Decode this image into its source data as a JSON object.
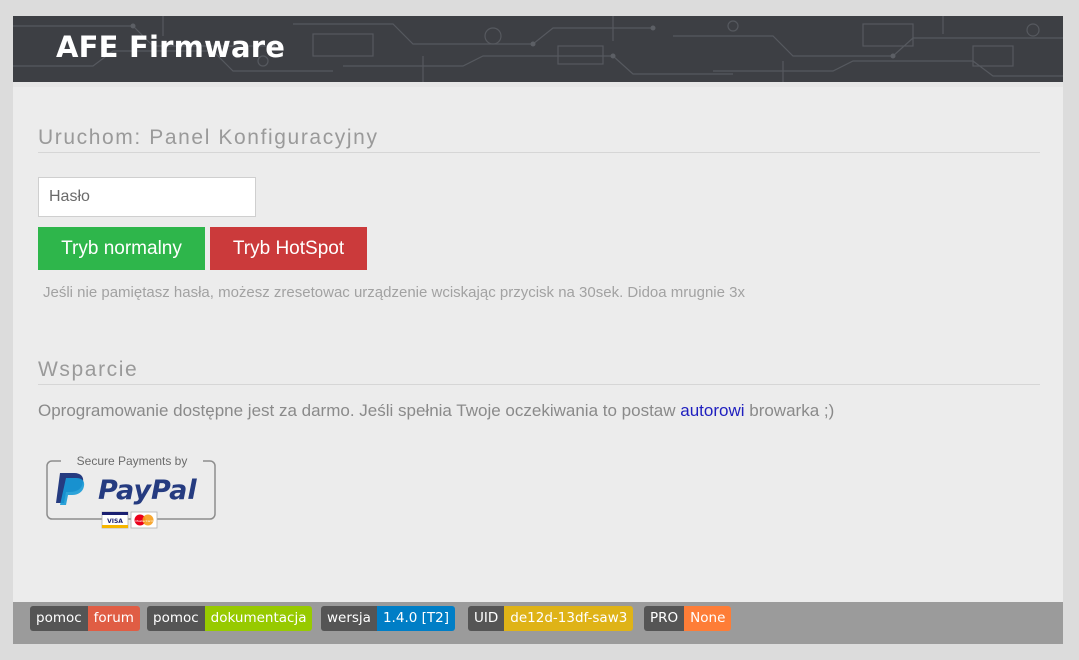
{
  "header": {
    "title": "AFE Firmware"
  },
  "launch": {
    "title": "Uruchom: Panel Konfiguracyjny",
    "password_placeholder": "Hasło",
    "normal_button": "Tryb normalny",
    "hotspot_button": "Tryb HotSpot",
    "hint": "Jeśli nie pamiętasz hasła, możesz zresetowac urządzenie wciskając przycisk na 30sek. Didoa mrugnie 3x"
  },
  "support": {
    "title": "Wsparcie",
    "text_before": "Oprogramowanie dostępne jest za darmo. Jeśli spełnia Twoje oczekiwania to postaw ",
    "link": "autorowi",
    "text_after": " browarka ;)",
    "paypal": {
      "caption": "Secure Payments by",
      "logo_text": "PayPal",
      "card1": "VISA",
      "card2": "MasterCard"
    }
  },
  "footer": {
    "badges": [
      {
        "label": "pomoc",
        "value": "forum",
        "color": "#e05d44"
      },
      {
        "label": "pomoc",
        "value": "dokumentacja",
        "color": "#97ca00"
      },
      {
        "label": "wersja",
        "value": "1.4.0 [T2]",
        "color": "#007ec6"
      },
      {
        "label": "UID",
        "value": "de12d-13df-saw3",
        "color": "#dfb317"
      },
      {
        "label": "PRO",
        "value": "None",
        "color": "#fe7d37"
      }
    ]
  }
}
